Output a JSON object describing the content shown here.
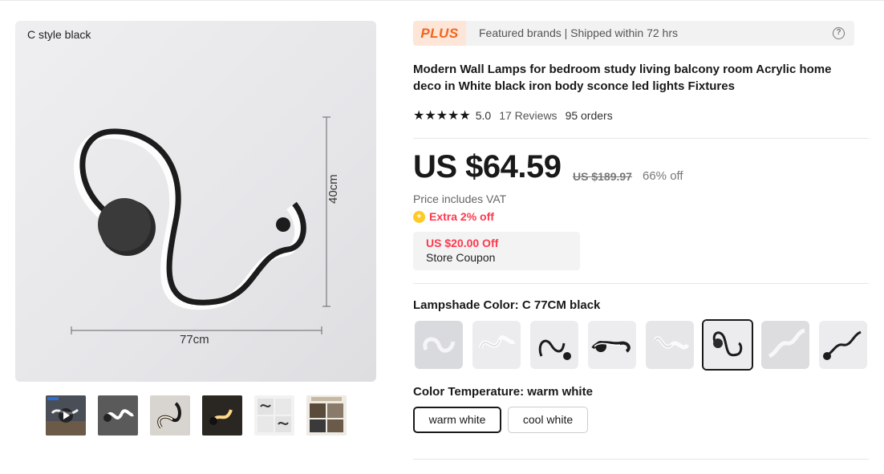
{
  "gallery": {
    "caption": "C style black",
    "dim_height": "40cm",
    "dim_width": "77cm",
    "thumbnails": [
      {
        "name": "video-thumbnail",
        "has_play": true
      },
      {
        "name": "thumbnail-2"
      },
      {
        "name": "thumbnail-3"
      },
      {
        "name": "thumbnail-4"
      },
      {
        "name": "thumbnail-5"
      },
      {
        "name": "thumbnail-6"
      }
    ]
  },
  "plus": {
    "badge": "PLUS",
    "text": "Featured brands | Shipped within 72 hrs",
    "help_icon": "?"
  },
  "product": {
    "title": "Modern Wall Lamps for bedroom study living balcony room Acrylic home deco in White black iron body sconce led lights Fixtures",
    "stars": "★★★★★",
    "rating": "5.0",
    "reviews": "17 Reviews",
    "orders": "95 orders"
  },
  "pricing": {
    "price": "US $64.59",
    "original_price": "US $189.97",
    "discount": "66% off",
    "vat_note": "Price includes VAT",
    "extra_icon": "+",
    "extra_discount": "Extra 2% off",
    "coupon_amount": "US $20.00 Off",
    "coupon_label": "Store Coupon"
  },
  "options": {
    "color_label": "Lampshade Color: C 77CM black",
    "swatch_selected_index": 5,
    "swatch_count": 8,
    "temp_label": "Color Temperature: warm white",
    "temperatures": [
      "warm white",
      "cool white"
    ],
    "temp_selected_index": 0
  },
  "colors": {
    "plus_orange": "#f0651d",
    "plus_bg": "#fde5d7",
    "sale_red": "#fd384f",
    "extra_yellow": "#ffc926"
  }
}
